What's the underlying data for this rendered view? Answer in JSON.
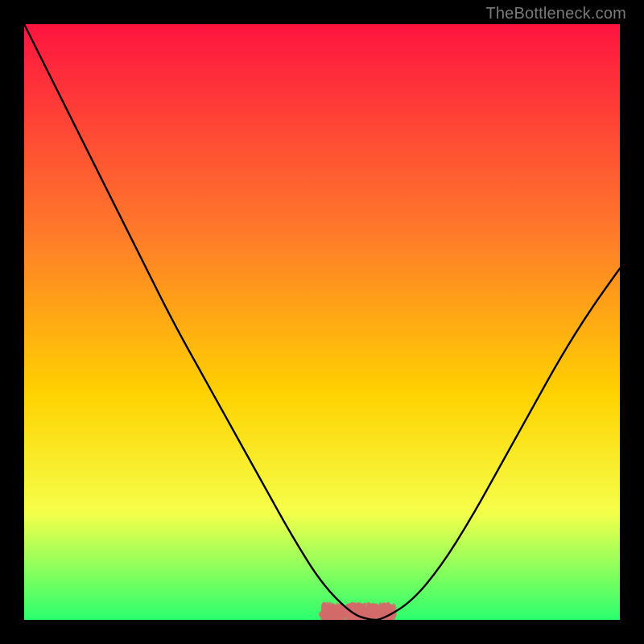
{
  "watermark": "TheBottleneck.com",
  "colors": {
    "gradient_top": "#ff1440",
    "gradient_mid1": "#ff7a2a",
    "gradient_mid2": "#ffd200",
    "gradient_mid3": "#f5ff4a",
    "gradient_bottom": "#2bff6e",
    "curve": "#000000",
    "spark_band": "#d46a6a",
    "frame_bg": "#000000"
  },
  "chart_data": {
    "type": "line",
    "title": "",
    "xlabel": "",
    "ylabel": "",
    "xlim": [
      0,
      100
    ],
    "ylim": [
      0,
      100
    ],
    "x": [
      0,
      5,
      10,
      15,
      20,
      25,
      30,
      35,
      40,
      45,
      50,
      55,
      58,
      60,
      65,
      70,
      75,
      80,
      85,
      90,
      95,
      100
    ],
    "values": [
      100,
      90,
      80,
      70,
      60,
      50,
      41,
      32,
      23,
      14,
      6,
      1,
      0,
      0,
      3,
      9,
      17,
      26,
      35,
      44,
      52,
      59
    ],
    "spark_band": {
      "x_range": [
        50,
        62
      ],
      "y_level": 2
    },
    "background_gradient": {
      "direction": "vertical",
      "stops": [
        {
          "pos": 0.0,
          "color": "#ff1440"
        },
        {
          "pos": 0.35,
          "color": "#ff7a2a"
        },
        {
          "pos": 0.62,
          "color": "#ffd200"
        },
        {
          "pos": 0.82,
          "color": "#f5ff4a"
        },
        {
          "pos": 1.0,
          "color": "#2bff6e"
        }
      ]
    }
  }
}
